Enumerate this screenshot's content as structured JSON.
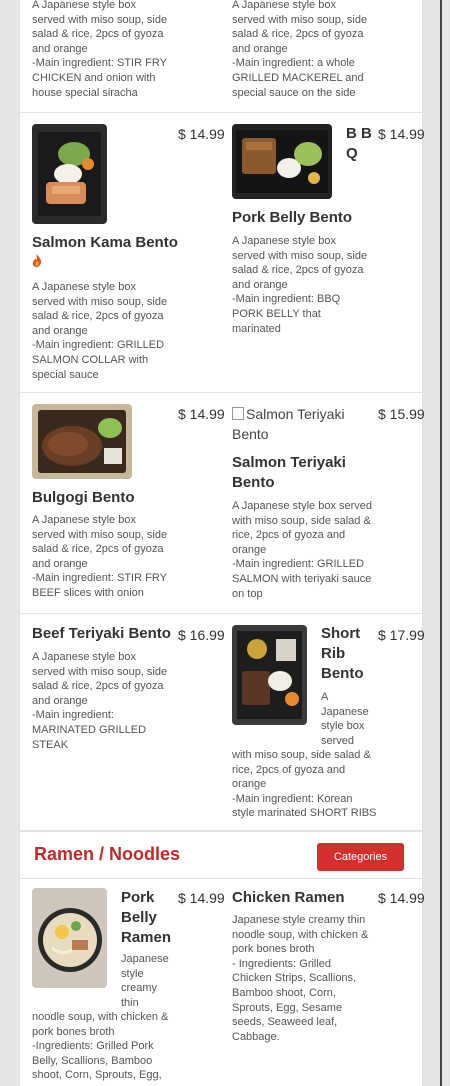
{
  "menu": {
    "rows": [
      {
        "left": {
          "desc": "A Japanese style box served with miso soup, side salad & rice, 2pcs of gyoza and orange\n-Main ingredient: STIR FRY CHICKEN and onion with house special siracha"
        },
        "right": {
          "desc": "A Japanese style box served with miso soup, side salad & rice, 2pcs of gyoza and orange\n-Main ingredient: a whole GRILLED MACKEREL and special sauce on the side"
        }
      },
      {
        "left": {
          "name": "Salmon Kama Bento",
          "price": "$ 14.99",
          "desc": "A Japanese style box served with miso soup, side salad & rice, 2pcs of gyoza and orange\n-Main ingredient: GRILLED SALMON COLLAR with special sauce",
          "icon": "fire-icon"
        },
        "right": {
          "badge": "B B Q",
          "name": "Pork Belly Bento",
          "price": "$ 14.99",
          "desc": "A Japanese style box served with miso soup, side salad & rice, 2pcs of gyoza and orange\n-Main ingredient: BBQ PORK BELLY that marinated"
        }
      },
      {
        "left": {
          "name": "Bulgogi Bento",
          "price": "$ 14.99",
          "desc": "A Japanese style box served with miso soup, side salad & rice, 2pcs of gyoza and orange\n-Main ingredient: STIR FRY BEEF slices with onion"
        },
        "right": {
          "alt": "Salmon Teriyaki Bento",
          "name": "Salmon Teriyaki Bento",
          "price": "$ 15.99",
          "desc": "A Japanese style box served with miso soup, side salad & rice, 2pcs of gyoza and orange\n-Main ingredient: GRILLED SALMON with teriyaki sauce on top"
        }
      },
      {
        "left": {
          "name": "Beef Teriyaki Bento",
          "price": "$ 16.99",
          "desc": "A Japanese style box served with miso soup, side salad & rice, 2pcs of gyoza and orange\n-Main ingredient: MARINATED GRILLED STEAK"
        },
        "right": {
          "name": "Short Rib Bento",
          "price": "$ 17.99",
          "desc_narrow": "A Japanese style box served",
          "desc_wide": "with miso soup, side salad & rice, 2pcs of gyoza and orange\n-Main ingredient: Korean style marinated SHORT RIBS"
        }
      }
    ]
  },
  "ramen_section": {
    "title": "Ramen / Noodles",
    "categories_label": "Categories",
    "items": [
      {
        "name": "Pork Belly Ramen",
        "price": "$ 14.99",
        "desc_narrow": "Japanese style creamy thin",
        "desc_wide": "noodle soup, with chicken & pork bones broth\n-Ingredients: Grilled Pork Belly, Scallions, Bamboo shoot, Corn, Sprouts, Egg,"
      },
      {
        "name": "Chicken Ramen",
        "price": "$ 14.99",
        "desc": "Japanese style creamy thin noodle soup, with chicken & pork bones broth\n- Ingredients: Grilled Chicken Strips, Scallions, Bamboo shoot, Corn, Sprouts, Egg, Sesame seeds, Seaweed leaf, Cabbage."
      }
    ]
  },
  "colors": {
    "accent": "#d32f2f",
    "section_title": "#c62828"
  }
}
